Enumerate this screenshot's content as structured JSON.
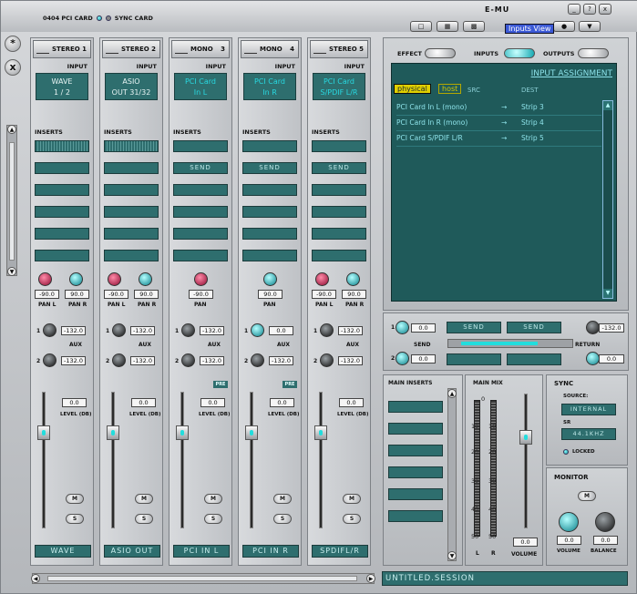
{
  "topbar": {
    "card1": "0404 PCI CARD",
    "card2": "SYNC CARD",
    "brand": "E-MU"
  },
  "window_buttons": [
    "_",
    "?",
    "x"
  ],
  "toolbar_icons": [
    "new-file-icon",
    "open-file-icon",
    "save-icon",
    "info-icon",
    "dropdown-icon"
  ],
  "side": {
    "star": "*",
    "close": "x"
  },
  "strips": [
    {
      "type": "STEREO",
      "num": "1",
      "input_label": "INPUT",
      "lcd1": "WAVE",
      "lcd2": "1 / 2",
      "lcd_style": "white",
      "inserts": "INSERTS",
      "pan_type": "stereo",
      "pan_l": "-90.0",
      "pan_r": "90.0",
      "panl_label": "PAN L",
      "panr_label": "PAN R",
      "aux_label": "AUX",
      "aux1": "-132.0",
      "aux2": "-132.0",
      "pre": "",
      "level": "0.0",
      "level_label": "LEVEL (DB)",
      "mute": "M",
      "solo": "S",
      "name": "WAVE"
    },
    {
      "type": "STEREO",
      "num": "2",
      "input_label": "INPUT",
      "lcd1": "ASIO",
      "lcd2": "OUT 31/32",
      "lcd_style": "white",
      "inserts": "INSERTS",
      "pan_type": "stereo",
      "pan_l": "-90.0",
      "pan_r": "90.0",
      "panl_label": "PAN L",
      "panr_label": "PAN R",
      "aux_label": "AUX",
      "aux1": "-132.0",
      "aux2": "-132.0",
      "pre": "",
      "level": "0.0",
      "level_label": "LEVEL (DB)",
      "mute": "M",
      "solo": "S",
      "name": "ASIO OUT"
    },
    {
      "type": "MONO",
      "num": "3",
      "input_label": "INPUT",
      "lcd1": "PCI Card",
      "lcd2": "In L",
      "lcd_style": "cyan",
      "inserts": "INSERTS",
      "pan_type": "mono",
      "pan": "-90.0",
      "pan_label": "PAN",
      "pan_color": "red",
      "aux_label": "AUX",
      "aux1": "-132.0",
      "aux2": "-132.0",
      "pre": "PRE",
      "send": "SEND",
      "level": "0.0",
      "level_label": "LEVEL (DB)",
      "mute": "M",
      "solo": "S",
      "name": "PCI IN L"
    },
    {
      "type": "MONO",
      "num": "4",
      "input_label": "INPUT",
      "lcd1": "PCI Card",
      "lcd2": "In R",
      "lcd_style": "cyan",
      "inserts": "INSERTS",
      "pan_type": "mono",
      "pan": "90.0",
      "pan_label": "PAN",
      "pan_color": "cyan",
      "aux_label": "AUX",
      "aux1": "0.0",
      "aux2": "-132.0",
      "pre": "PRE",
      "send": "SEND",
      "level": "0.0",
      "level_label": "LEVEL (DB)",
      "mute": "M",
      "solo": "S",
      "name": "PCI IN R"
    },
    {
      "type": "STEREO",
      "num": "5",
      "input_label": "INPUT",
      "lcd1": "PCI Card",
      "lcd2": "S/PDIF L/R",
      "lcd_style": "cyan",
      "inserts": "INSERTS",
      "pan_type": "stereo",
      "pan_l": "-90.0",
      "pan_r": "90.0",
      "panl_label": "PAN L",
      "panr_label": "PAN R",
      "aux_label": "AUX",
      "aux1": "-132.0",
      "aux2": "-132.0",
      "pre": "",
      "send": "SEND",
      "level": "0.0",
      "level_label": "LEVEL (DB)",
      "mute": "M",
      "solo": "S",
      "name": "SPDIFL/R"
    }
  ],
  "router": {
    "effect": "EFFECT",
    "inputs": "INPUTS",
    "outputs": "OUTPUTS",
    "tooltip": "Inputs View",
    "assignment_title": "INPUT ASSIGNMENT",
    "physical": "physical",
    "host": "host",
    "src": "SRC",
    "dest": "DEST",
    "rows": [
      {
        "src": "PCI Card In L (mono)",
        "arrow": "→",
        "dest": "Strip 3"
      },
      {
        "src": "PCI Card In R (mono)",
        "arrow": "→",
        "dest": "Strip 4"
      },
      {
        "src": "PCI Card S/PDIF L/R",
        "arrow": "→",
        "dest": "Strip 5"
      }
    ]
  },
  "sends": {
    "send_label": "SEND",
    "return_label": "RETURN",
    "send1": "0.0",
    "send2": "0.0",
    "ret1": "-132.0",
    "ret2": "0.0",
    "slot1": "SEND",
    "slot2": "SEND",
    "n1": "1",
    "n2": "2"
  },
  "main_inserts": {
    "title": "MAIN INSERTS"
  },
  "main_mix": {
    "title": "MAIN MIX",
    "scale": [
      "0",
      "10",
      "20",
      "30",
      "40",
      "50",
      "10",
      "20",
      "30",
      "40",
      "50"
    ],
    "volume": "0.0",
    "volume_label": "VOLUME",
    "l": "L",
    "r": "R"
  },
  "sync": {
    "title": "SYNC",
    "source_label": "SOURCE:",
    "source": "INTERNAL",
    "sr_label": "SR",
    "sr": "44.1KHZ",
    "locked": "LOCKED"
  },
  "monitor": {
    "title": "MONITOR",
    "mute": "M",
    "volume": "0.0",
    "balance": "0.0",
    "volume_label": "VOLUME",
    "balance_label": "BALANCE"
  },
  "session": "UNTITLED.SESSION"
}
